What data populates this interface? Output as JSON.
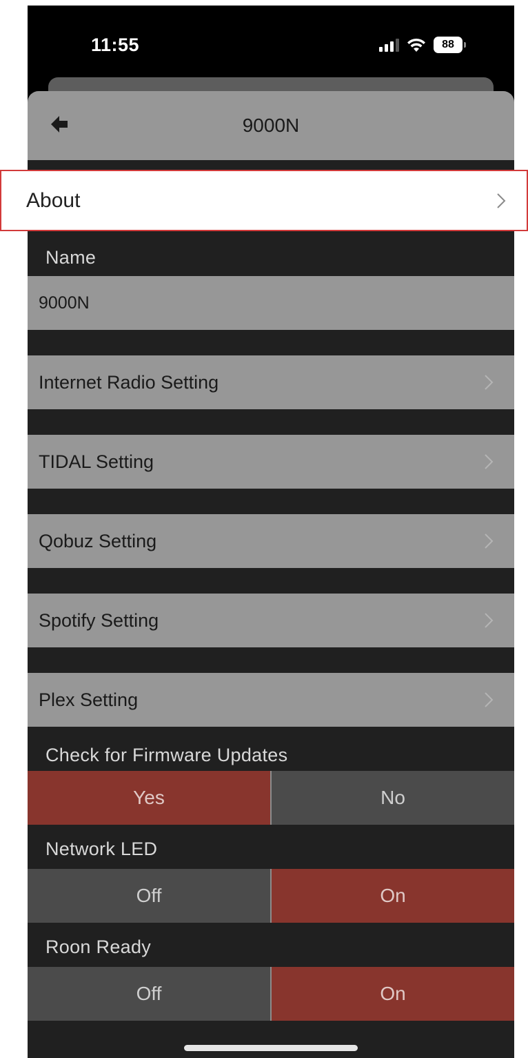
{
  "status_bar": {
    "time": "11:55",
    "battery": "88"
  },
  "header": {
    "title": "9000N"
  },
  "about": {
    "label": "About"
  },
  "name_section": {
    "label": "Name",
    "value": "9000N"
  },
  "settings": [
    {
      "label": "Internet Radio Setting"
    },
    {
      "label": "TIDAL Setting"
    },
    {
      "label": "Qobuz Setting"
    },
    {
      "label": "Spotify Setting"
    },
    {
      "label": "Plex Setting"
    }
  ],
  "firmware": {
    "label": "Check for Firmware Updates",
    "options": [
      "Yes",
      "No"
    ],
    "selected": "Yes"
  },
  "network_led": {
    "label": "Network LED",
    "options": [
      "Off",
      "On"
    ],
    "selected": "On"
  },
  "roon_ready": {
    "label": "Roon Ready",
    "options": [
      "Off",
      "On"
    ],
    "selected": "On"
  },
  "colors": {
    "accent": "#88352d",
    "row_bg": "#979797",
    "sheet_bg": "#202020",
    "highlight_border": "#d23a3a"
  }
}
